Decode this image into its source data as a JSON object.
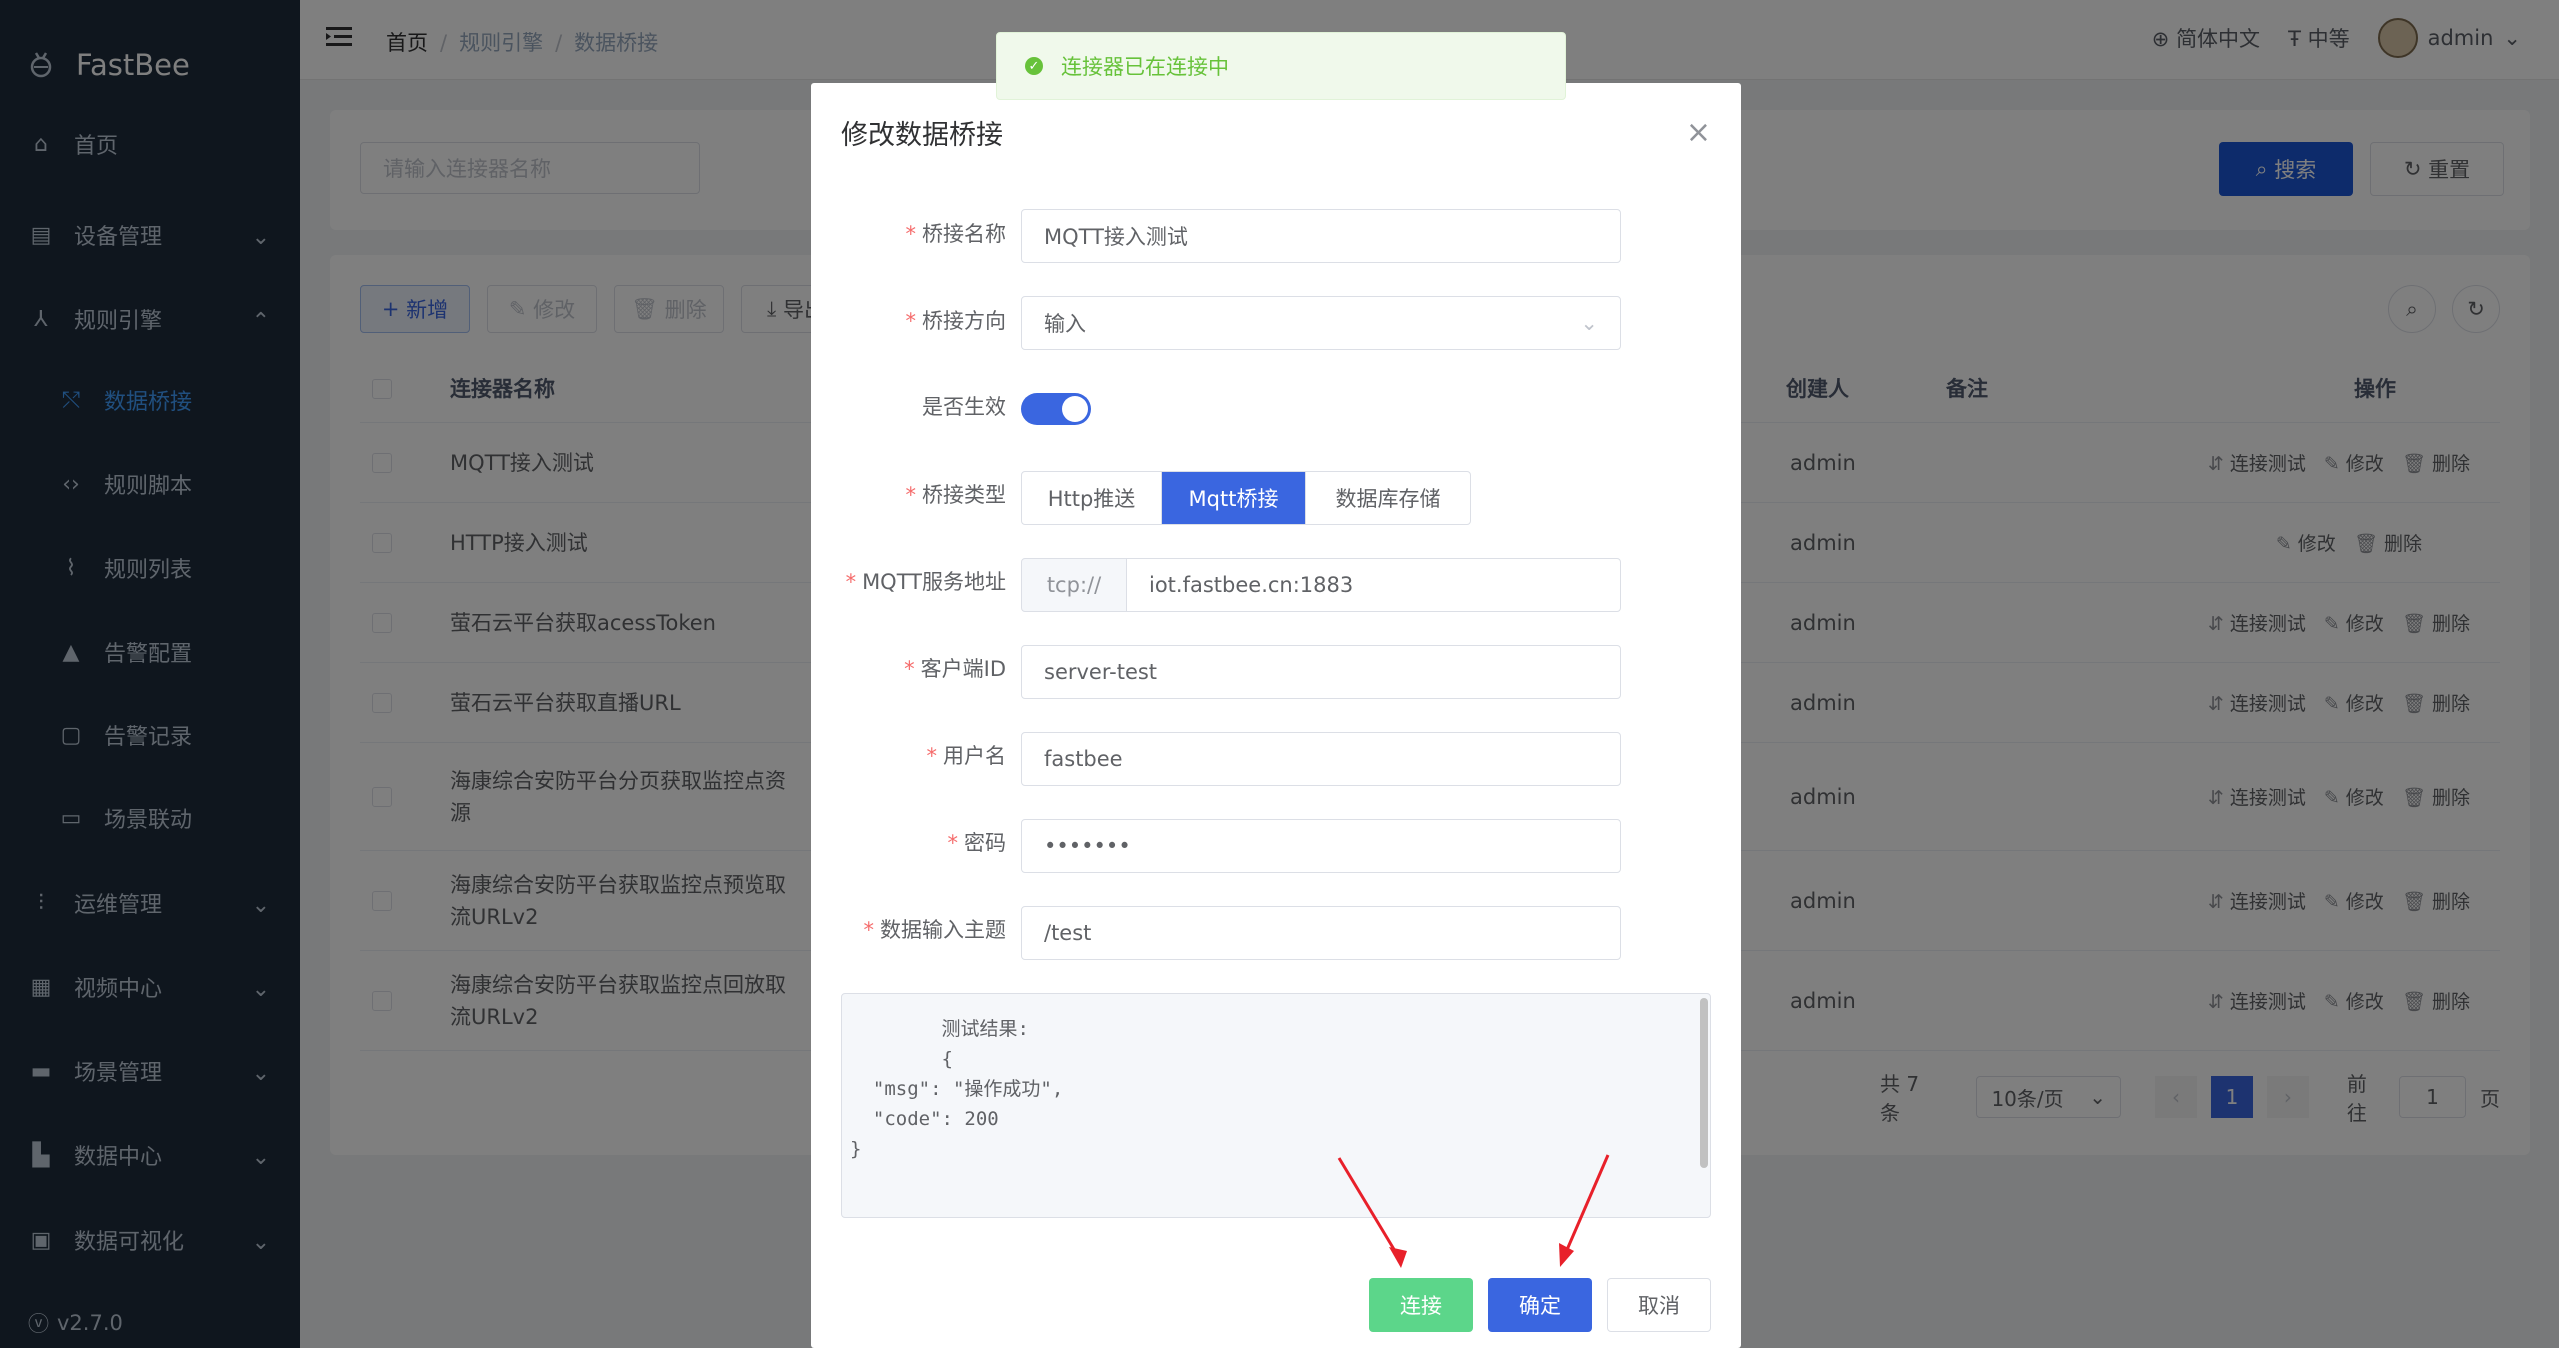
{
  "app": {
    "name": "FastBee",
    "version": "v2.7.0"
  },
  "sidebar": {
    "items": [
      {
        "label": "首页",
        "icon": "home-icon"
      },
      {
        "label": "设备管理",
        "icon": "device-icon"
      },
      {
        "label": "规则引擎",
        "icon": "rule-engine-icon"
      },
      {
        "label": "数据桥接",
        "icon": "bridge-icon"
      },
      {
        "label": "规则脚本",
        "icon": "code-icon"
      },
      {
        "label": "规则列表",
        "icon": "list-icon"
      },
      {
        "label": "告警配置",
        "icon": "alarm-icon"
      },
      {
        "label": "告警记录",
        "icon": "record-icon"
      },
      {
        "label": "场景联动",
        "icon": "scene-icon"
      },
      {
        "label": "运维管理",
        "icon": "ops-icon"
      },
      {
        "label": "视频中心",
        "icon": "video-icon"
      },
      {
        "label": "场景管理",
        "icon": "scene-manage-icon"
      },
      {
        "label": "数据中心",
        "icon": "data-icon"
      },
      {
        "label": "数据可视化",
        "icon": "visual-icon"
      }
    ]
  },
  "header": {
    "breadcrumb": [
      "首页",
      "规则引擎",
      "数据桥接"
    ],
    "language": "简体中文",
    "font_size": "中等",
    "user": "admin"
  },
  "search": {
    "placeholder": "请输入连接器名称",
    "search_label": "搜索",
    "reset_label": "重置"
  },
  "toolbar": {
    "add_label": "新增",
    "edit_label": "修改",
    "delete_label": "删除",
    "export_label": "导出"
  },
  "table": {
    "headers": {
      "name": "连接器名称",
      "creator": "创建人",
      "remark": "备注",
      "ops": "操作"
    },
    "rows": [
      {
        "name": "MQTT接入测试",
        "creator": "admin",
        "test": true
      },
      {
        "name": "HTTP接入测试",
        "creator": "admin",
        "test": false
      },
      {
        "name": "萤石云平台获取acessToken",
        "creator": "admin",
        "test": true
      },
      {
        "name": "萤石云平台获取直播URL",
        "creator": "admin",
        "test": true
      },
      {
        "name": "海康综合安防平台分页获取监控点资源",
        "creator": "admin",
        "test": true
      },
      {
        "name": "海康综合安防平台获取监控点预览取流URLv2",
        "creator": "admin",
        "test": true
      },
      {
        "name": "海康综合安防平台获取监控点回放取流URLv2",
        "creator": "admin",
        "test": true
      }
    ],
    "op_labels": {
      "test": "连接测试",
      "edit": "修改",
      "delete": "删除"
    }
  },
  "pagination": {
    "total": "共 7 条",
    "page_size": "10条/页",
    "current": "1",
    "goto_label": "前往",
    "goto_value": "1",
    "page_suffix": "页"
  },
  "toast": {
    "message": "连接器已在连接中"
  },
  "dialog": {
    "title": "修改数据桥接",
    "fields": {
      "name_label": "桥接名称",
      "name_value": "MQTT接入测试",
      "direction_label": "桥接方向",
      "direction_value": "输入",
      "enabled_label": "是否生效",
      "enabled": true,
      "type_label": "桥接类型",
      "type_options": [
        "Http推送",
        "Mqtt桥接",
        "数据库存储"
      ],
      "type_selected": "Mqtt桥接",
      "server_label": "MQTT服务地址",
      "server_prefix": "tcp://",
      "server_value": "iot.fastbee.cn:1883",
      "client_label": "客户端ID",
      "client_value": "server-test",
      "user_label": "用户名",
      "user_value": "fastbee",
      "password_label": "密码",
      "password_value": "•••••••",
      "topic_label": "数据输入主题",
      "topic_value": "/test"
    },
    "result_text": "        测试结果:\n        {\n  \"msg\": \"操作成功\",\n  \"code\": 200\n}",
    "buttons": {
      "connect": "连接",
      "confirm": "确定",
      "cancel": "取消"
    }
  },
  "colors": {
    "primary": "#3a66e0",
    "success": "#67c23a",
    "sidebar": "#1f2d3d"
  }
}
